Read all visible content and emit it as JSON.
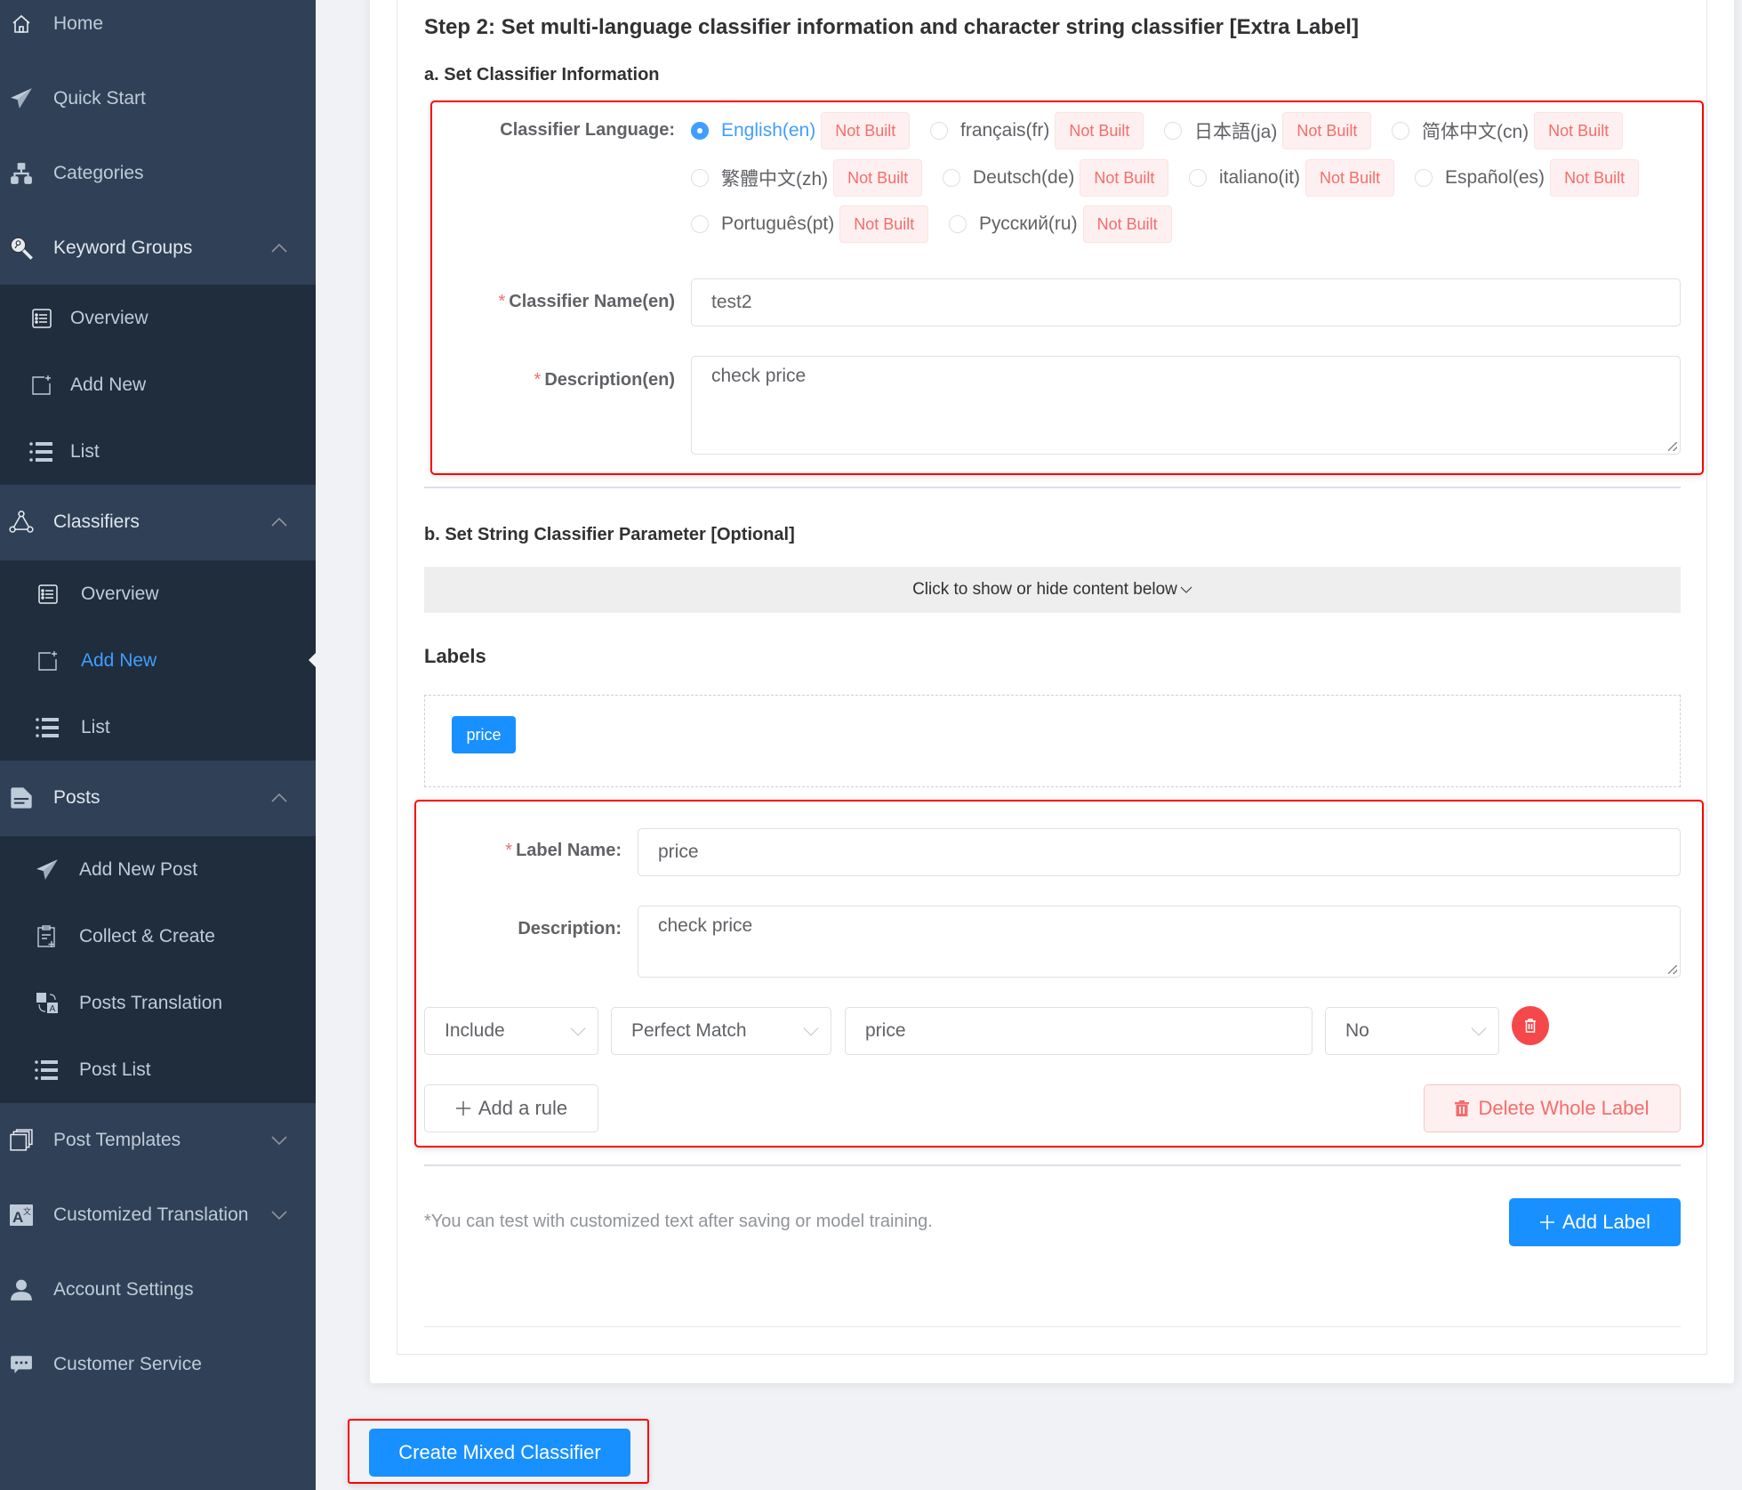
{
  "sidebar": {
    "items": [
      {
        "label": "Home",
        "icon": "home-icon"
      },
      {
        "label": "Quick Start",
        "icon": "paper-plane-icon"
      },
      {
        "label": "Categories",
        "icon": "sitemap-icon"
      },
      {
        "label": "Keyword Groups",
        "icon": "key-search-icon",
        "expanded": true,
        "children": [
          {
            "label": "Overview",
            "icon": "list-box-icon"
          },
          {
            "label": "Add New",
            "icon": "add-document-icon"
          },
          {
            "label": "List",
            "icon": "list-icon"
          }
        ]
      },
      {
        "label": "Classifiers",
        "icon": "network-icon",
        "expanded": true,
        "children": [
          {
            "label": "Overview",
            "icon": "list-box-icon"
          },
          {
            "label": "Add New",
            "icon": "add-document-icon",
            "active": true
          },
          {
            "label": "List",
            "icon": "list-icon"
          }
        ]
      },
      {
        "label": "Posts",
        "icon": "document-icon",
        "expanded": true,
        "children": [
          {
            "label": "Add New Post",
            "icon": "paper-plane-icon"
          },
          {
            "label": "Collect & Create",
            "icon": "clipboard-add-icon"
          },
          {
            "label": "Posts Translation",
            "icon": "translate-icon"
          },
          {
            "label": "Post List",
            "icon": "list-icon"
          }
        ]
      },
      {
        "label": "Post Templates",
        "icon": "copy-icon",
        "expanded": false
      },
      {
        "label": "Customized Translation",
        "icon": "language-icon",
        "expanded": false
      },
      {
        "label": "Account Settings",
        "icon": "user-icon"
      },
      {
        "label": "Customer Service",
        "icon": "chat-icon"
      }
    ]
  },
  "main": {
    "step_title": "Step 2: Set multi-language classifier information and character string classifier [Extra Label]",
    "section_a_title": "a. Set Classifier Information",
    "classifier_language_label": "Classifier Language:",
    "languages": [
      {
        "label": "English(en)",
        "status": "Not Built",
        "selected": true
      },
      {
        "label": "français(fr)",
        "status": "Not Built",
        "selected": false
      },
      {
        "label": "日本語(ja)",
        "status": "Not Built",
        "selected": false
      },
      {
        "label": "简体中文(cn)",
        "status": "Not Built",
        "selected": false
      },
      {
        "label": "繁體中文(zh)",
        "status": "Not Built",
        "selected": false
      },
      {
        "label": "Deutsch(de)",
        "status": "Not Built",
        "selected": false
      },
      {
        "label": "italiano(it)",
        "status": "Not Built",
        "selected": false
      },
      {
        "label": "Español(es)",
        "status": "Not Built",
        "selected": false
      },
      {
        "label": "Português(pt)",
        "status": "Not Built",
        "selected": false
      },
      {
        "label": "Русский(ru)",
        "status": "Not Built",
        "selected": false
      }
    ],
    "classifier_name_label": "Classifier Name(en)",
    "classifier_name_value": "test2",
    "description_label": "Description(en)",
    "description_value": "check price",
    "section_b_title": "b. Set String Classifier Parameter [Optional]",
    "collapse_toggle_label": "Click to show or hide content below",
    "labels_title": "Labels",
    "label_chips": [
      "price"
    ],
    "label_editor": {
      "label_name_label": "Label Name:",
      "label_name_value": "price",
      "description_label": "Description:",
      "description_value": "check price",
      "rule": {
        "include_select": "Include",
        "match_select": "Perfect Match",
        "keyword_value": "price",
        "case_select": "No"
      },
      "add_rule_label": "Add a rule",
      "delete_label_button": "Delete Whole Label"
    },
    "hint_text": "*You can test with customized text after saving or model training.",
    "add_label_button": "Add Label",
    "create_button": "Create Mixed Classifier"
  },
  "colors": {
    "sidebar_bg": "#304056",
    "submenu_bg": "#1f2d3d",
    "accent": "#1890ff",
    "danger": "#f56c6c",
    "highlight_border": "#ff0000"
  }
}
